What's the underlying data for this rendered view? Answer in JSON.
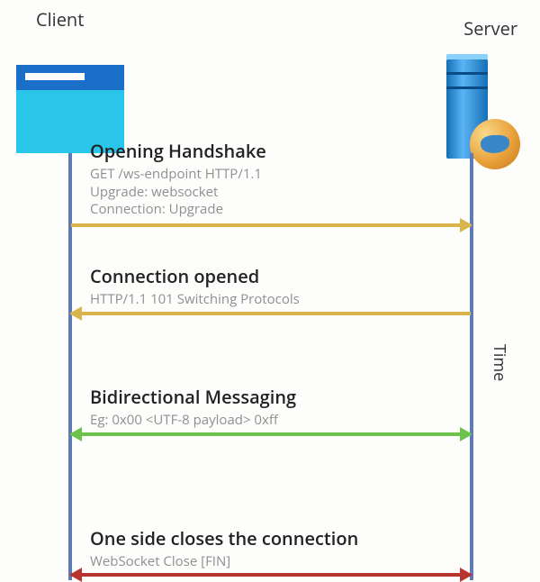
{
  "header": {
    "client": "Client",
    "server": "Server",
    "time": "Time"
  },
  "steps": [
    {
      "id": "handshake",
      "title": "Opening Handshake",
      "detail": "GET /ws-endpoint HTTP/1.1\nUpgrade: websocket\nConnection: Upgrade",
      "direction": "right",
      "color": "gold"
    },
    {
      "id": "opened",
      "title": "Connection opened",
      "detail": "HTTP/1.1 101 Switching Protocols",
      "direction": "left",
      "color": "gold"
    },
    {
      "id": "messaging",
      "title": "Bidirectional Messaging",
      "detail": "Eg: 0x00 <UTF-8 payload> 0xff",
      "direction": "both",
      "color": "green"
    },
    {
      "id": "close",
      "title": "One side closes the connection",
      "detail": "WebSocket Close [FIN]",
      "direction": "both",
      "color": "red"
    }
  ]
}
